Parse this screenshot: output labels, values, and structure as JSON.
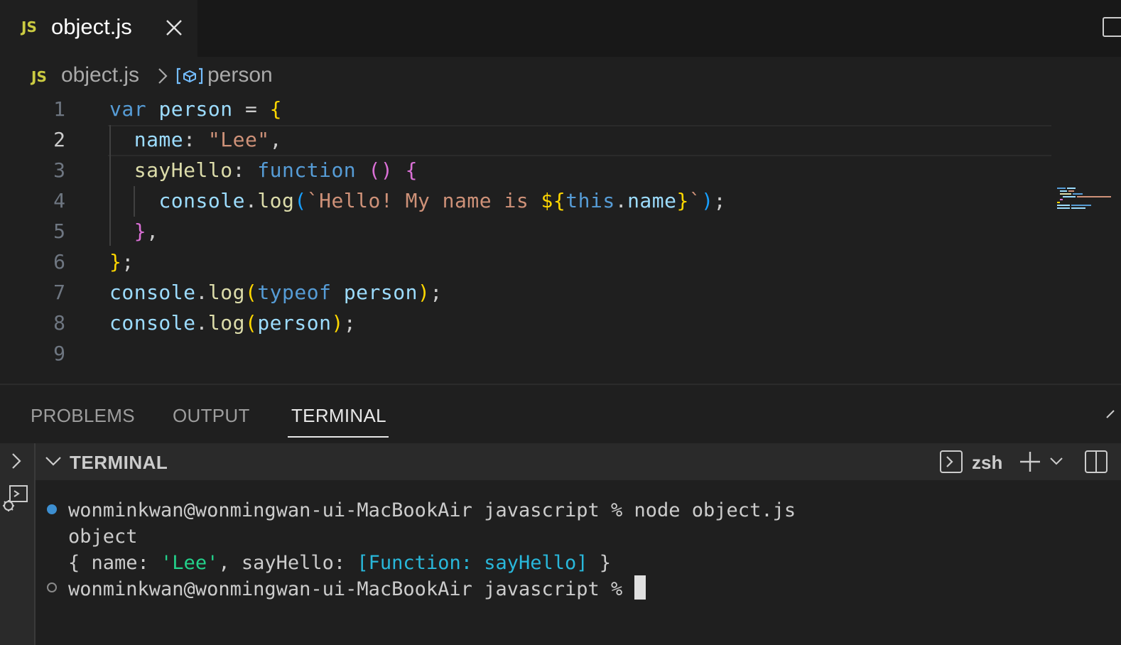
{
  "tab": {
    "icon": "JS",
    "label": "object.js"
  },
  "breadcrumb": {
    "icon": "JS",
    "file": "object.js",
    "symbol": "person"
  },
  "editor": {
    "line_numbers": [
      "1",
      "2",
      "3",
      "4",
      "5",
      "6",
      "7",
      "8",
      "9"
    ],
    "active_line": "2",
    "lines": [
      [
        [
          "kw",
          "var"
        ],
        [
          "plain",
          " "
        ],
        [
          "var",
          "person"
        ],
        [
          "plain",
          " = "
        ],
        [
          "brace1",
          "{"
        ]
      ],
      [
        [
          "plain",
          "  "
        ],
        [
          "prop",
          "name"
        ],
        [
          "plain",
          ": "
        ],
        [
          "str",
          "\"Lee\""
        ],
        [
          "plain",
          ","
        ]
      ],
      [
        [
          "plain",
          "  "
        ],
        [
          "fn",
          "sayHello"
        ],
        [
          "plain",
          ": "
        ],
        [
          "kw",
          "function"
        ],
        [
          "plain",
          " "
        ],
        [
          "brace2",
          "()"
        ],
        [
          "plain",
          " "
        ],
        [
          "brace2",
          "{"
        ]
      ],
      [
        [
          "plain",
          "    "
        ],
        [
          "var",
          "console"
        ],
        [
          "plain",
          "."
        ],
        [
          "fn",
          "log"
        ],
        [
          "brace3",
          "("
        ],
        [
          "str",
          "`Hello! My name is "
        ],
        [
          "brace1",
          "${"
        ],
        [
          "kw",
          "this"
        ],
        [
          "plain",
          "."
        ],
        [
          "prop",
          "name"
        ],
        [
          "brace1",
          "}"
        ],
        [
          "str",
          "`"
        ],
        [
          "brace3",
          ")"
        ],
        [
          "plain",
          ";"
        ]
      ],
      [
        [
          "plain",
          "  "
        ],
        [
          "brace2",
          "}"
        ],
        [
          "plain",
          ","
        ]
      ],
      [
        [
          "brace1",
          "}"
        ],
        [
          "plain",
          ";"
        ]
      ],
      [
        [
          "var",
          "console"
        ],
        [
          "plain",
          "."
        ],
        [
          "fn",
          "log"
        ],
        [
          "brace1",
          "("
        ],
        [
          "kw",
          "typeof"
        ],
        [
          "plain",
          " "
        ],
        [
          "var",
          "person"
        ],
        [
          "brace1",
          ")"
        ],
        [
          "plain",
          ";"
        ]
      ],
      [
        [
          "var",
          "console"
        ],
        [
          "plain",
          "."
        ],
        [
          "fn",
          "log"
        ],
        [
          "brace1",
          "("
        ],
        [
          "var",
          "person"
        ],
        [
          "brace1",
          ")"
        ],
        [
          "plain",
          ";"
        ]
      ],
      []
    ]
  },
  "panel": {
    "tabs": [
      "PROBLEMS",
      "OUTPUT",
      "TERMINAL"
    ],
    "active_tab": "TERMINAL",
    "terminal_title": "TERMINAL",
    "shell": "zsh"
  },
  "terminal": {
    "prompt1": "wonminkwan@wonmingwan-ui-MacBookAir javascript % node object.js",
    "out1": "object",
    "out2_pre": "{ name: ",
    "out2_str": "'Lee'",
    "out2_mid": ", sayHello: ",
    "out2_fn": "[Function: sayHello]",
    "out2_post": " }",
    "prompt2": "wonminkwan@wonmingwan-ui-MacBookAir javascript % "
  },
  "colors": {
    "background": "#1f1f1f",
    "keyword": "#569cd6",
    "string": "#ce9178",
    "function": "#dcdcaa",
    "terminal_green": "#23d18b",
    "terminal_cyan": "#29b8db"
  },
  "icons": [
    "js-file-icon",
    "close-icon",
    "split-editor-icon",
    "chevron-right-icon",
    "symbol-variable-icon",
    "maximize-panel-icon",
    "chevron-right-icon",
    "debug-console-icon",
    "chevron-down-icon",
    "terminal-icon",
    "plus-icon",
    "chevron-down-icon",
    "split-terminal-icon"
  ]
}
